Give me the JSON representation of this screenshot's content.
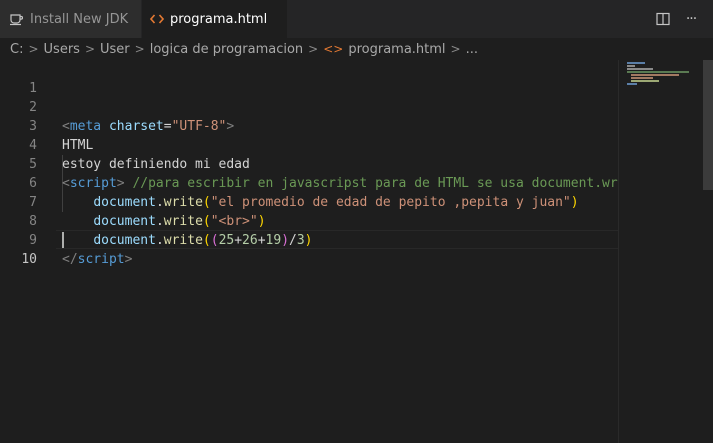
{
  "tabs": [
    {
      "label": "Install New JDK",
      "icon": "preview-icon",
      "active": false
    },
    {
      "label": "programa.html",
      "icon": "html-file-icon",
      "active": true,
      "modified": true
    }
  ],
  "tab_actions": [
    {
      "name": "split-editor-icon"
    },
    {
      "name": "more-actions-icon",
      "glyph": "···"
    }
  ],
  "breadcrumb": [
    "C:",
    "Users",
    "User",
    "logica de programacion",
    "programa.html",
    "..."
  ],
  "editor": {
    "line_numbers": [
      "1",
      "2",
      "3",
      "4",
      "5",
      "6",
      "7",
      "8",
      "9",
      "10"
    ],
    "lines": {
      "l2": {
        "open": "<",
        "tag": "meta",
        "attr": "charset",
        "eq": "=",
        "val": "\"UTF-8\"",
        "close": ">"
      },
      "l3": {
        "text": "HTML"
      },
      "l4": {
        "text": "estoy definiendo mi edad"
      },
      "l5": {
        "open": "<",
        "tag": "script",
        "close": ">",
        "comment": "//para escribir en javascripst para de HTML se usa document.write"
      },
      "l6": {
        "obj": "document",
        "dot": ".",
        "fn": "write",
        "p1": "(",
        "str": "\"el promedio de edad de pepito ,pepita y juan\"",
        "p2": ")"
      },
      "l7": {
        "obj": "document",
        "dot": ".",
        "fn": "write",
        "p1": "(",
        "str": "\"<br>\"",
        "p2": ")"
      },
      "l8": {
        "obj": "document",
        "dot": ".",
        "fn": "write",
        "p1": "(",
        "p2": "(",
        "n1": "25",
        "op1": "+",
        "n2": "26",
        "op2": "+",
        "n3": "19",
        "p3": ")",
        "op3": "/",
        "n4": "3",
        "p4": ")"
      },
      "l9": {
        "open": "</",
        "tag": "script",
        "close": ">"
      }
    }
  },
  "colors": {
    "tag": "#569cd6",
    "attribute": "#9cdcfe",
    "string": "#ce9178",
    "comment": "#6a9955",
    "function": "#dcdcaa",
    "number": "#b5cea8",
    "background": "#1e1e1e",
    "tab_bar": "#252526"
  }
}
